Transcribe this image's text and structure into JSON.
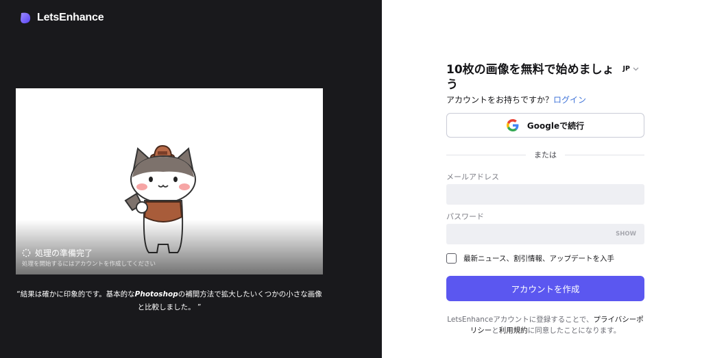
{
  "brand": {
    "name": "LetsEnhance",
    "accent": "#7b61ff"
  },
  "preview": {
    "status": "処理の準備完了",
    "sub": "処理を開始するにはアカウントを作成してください"
  },
  "quote": {
    "pre": "“結果は確かに印象的です。基本的な",
    "em": "Photoshop",
    "post": "の補間方法で拡大したいくつかの小さな画像と比較しました。 ”"
  },
  "signup": {
    "title": "10枚の画像を無料で始めましょう",
    "lang": "JP",
    "have_account": "アカウントをお持ちですか？",
    "login_link": "ログイン",
    "google_label": "Googleで続行",
    "or": "または",
    "email_label": "メールアドレス",
    "email_value": "",
    "password_label": "パスワード",
    "password_value": "",
    "show_label": "SHOW",
    "newsletter_label": "最新ニュース、割引情報、アップデートを入手",
    "create_label": "アカウントを作成",
    "create_color": "#5b57f0",
    "terms_pre": "LetsEnhanceアカウントに登録することで、",
    "terms_privacy": "プライバシーポリシー",
    "terms_mid": "と",
    "terms_tos": "利用規約",
    "terms_post": "に同意したことになります。"
  }
}
